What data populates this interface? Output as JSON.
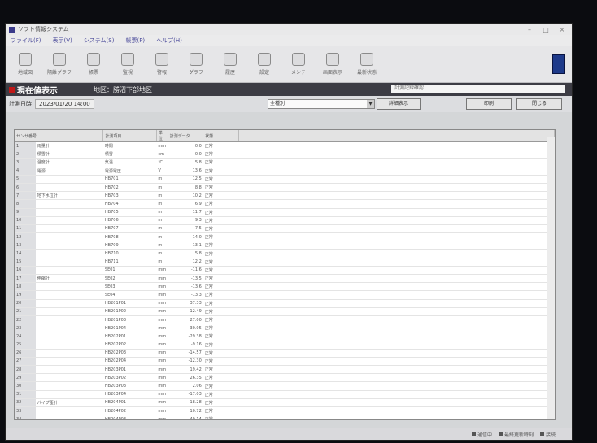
{
  "window": {
    "title": "ソフト情報システム"
  },
  "menu": [
    "ファイル(F)",
    "表示(V)",
    "システム(S)",
    "帳票(P)",
    "ヘルプ(H)"
  ],
  "toolbar": [
    {
      "label": "地域図",
      "icon": "map-icon"
    },
    {
      "label": "隔離グラフ",
      "icon": "graph-icon"
    },
    {
      "label": "帳票",
      "icon": "report-icon"
    },
    {
      "label": "監視",
      "icon": "monitor-icon"
    },
    {
      "label": "警報",
      "icon": "alarm-icon"
    },
    {
      "label": "グラフ",
      "icon": "chart-icon"
    },
    {
      "label": "履歴",
      "icon": "history-icon"
    },
    {
      "label": "設定",
      "icon": "settings-icon"
    },
    {
      "label": "メンテ",
      "icon": "maintenance-icon"
    },
    {
      "label": "画面表示",
      "icon": "display-icon"
    },
    {
      "label": "最新状態",
      "icon": "refresh-icon"
    }
  ],
  "header": {
    "title": "現在値表示",
    "area": "地区：勝沼下部地区",
    "record_label": "計測記録確認"
  },
  "controls": {
    "datetime_label": "計測日時",
    "datetime": "2023/01/20 14:00",
    "filter_value": "全種別",
    "detail_button": "詳細表示",
    "print_button": "印刷",
    "close_button": "閉じる"
  },
  "table": {
    "headers": [
      "センサ番号",
      "計測項目",
      "単位",
      "計測データ",
      "状態"
    ],
    "rows": [
      {
        "id": "1",
        "name": "雨量計",
        "item": "時間",
        "unit": "mm",
        "value": "0.0",
        "status": "正常"
      },
      {
        "id": "2",
        "name": "積雪計",
        "item": "積雪",
        "unit": "cm",
        "value": "0.0",
        "status": "正常"
      },
      {
        "id": "3",
        "name": "温度計",
        "item": "気温",
        "unit": "℃",
        "value": "5.8",
        "status": "正常"
      },
      {
        "id": "4",
        "name": "電源",
        "item": "電源電圧",
        "unit": "V",
        "value": "13.6",
        "status": "正常"
      },
      {
        "id": "5",
        "name": "",
        "item": "HB701",
        "unit": "m",
        "value": "12.5",
        "status": "正常"
      },
      {
        "id": "6",
        "name": "",
        "item": "HB702",
        "unit": "m",
        "value": "8.8",
        "status": "正常"
      },
      {
        "id": "7",
        "name": "地下水位計",
        "item": "HB703",
        "unit": "m",
        "value": "10.2",
        "status": "正常"
      },
      {
        "id": "8",
        "name": "",
        "item": "HB704",
        "unit": "m",
        "value": "6.9",
        "status": "正常"
      },
      {
        "id": "9",
        "name": "",
        "item": "HB705",
        "unit": "m",
        "value": "11.7",
        "status": "正常"
      },
      {
        "id": "10",
        "name": "",
        "item": "HB706",
        "unit": "m",
        "value": "9.3",
        "status": "正常"
      },
      {
        "id": "11",
        "name": "",
        "item": "HB707",
        "unit": "m",
        "value": "7.5",
        "status": "正常"
      },
      {
        "id": "12",
        "name": "",
        "item": "HB708",
        "unit": "m",
        "value": "14.0",
        "status": "正常"
      },
      {
        "id": "13",
        "name": "",
        "item": "HB709",
        "unit": "m",
        "value": "13.1",
        "status": "正常"
      },
      {
        "id": "14",
        "name": "",
        "item": "HB710",
        "unit": "m",
        "value": "5.8",
        "status": "正常"
      },
      {
        "id": "15",
        "name": "",
        "item": "HB711",
        "unit": "m",
        "value": "12.2",
        "status": "正常"
      },
      {
        "id": "16",
        "name": "",
        "item": "SE01",
        "unit": "mm",
        "value": "-11.6",
        "status": "正常"
      },
      {
        "id": "17",
        "name": "伸縮計",
        "item": "SE02",
        "unit": "mm",
        "value": "-13.5",
        "status": "正常"
      },
      {
        "id": "18",
        "name": "",
        "item": "SE03",
        "unit": "mm",
        "value": "-13.6",
        "status": "正常"
      },
      {
        "id": "19",
        "name": "",
        "item": "SE04",
        "unit": "mm",
        "value": "-13.3",
        "status": "正常"
      },
      {
        "id": "20",
        "name": "",
        "item": "HB201P01",
        "unit": "mm",
        "value": "37.33",
        "status": "正常"
      },
      {
        "id": "21",
        "name": "",
        "item": "HB201P02",
        "unit": "mm",
        "value": "12.49",
        "status": "正常"
      },
      {
        "id": "22",
        "name": "",
        "item": "HB201P03",
        "unit": "mm",
        "value": "27.00",
        "status": "正常"
      },
      {
        "id": "23",
        "name": "",
        "item": "HB201P04",
        "unit": "mm",
        "value": "30.05",
        "status": "正常"
      },
      {
        "id": "24",
        "name": "",
        "item": "HB202P01",
        "unit": "mm",
        "value": "-29.38",
        "status": "正常"
      },
      {
        "id": "25",
        "name": "",
        "item": "HB202P02",
        "unit": "mm",
        "value": "-9.16",
        "status": "正常"
      },
      {
        "id": "26",
        "name": "",
        "item": "HB202P03",
        "unit": "mm",
        "value": "-14.57",
        "status": "正常"
      },
      {
        "id": "27",
        "name": "",
        "item": "HB202P04",
        "unit": "mm",
        "value": "-12.30",
        "status": "正常"
      },
      {
        "id": "28",
        "name": "",
        "item": "HB203P01",
        "unit": "mm",
        "value": "19.42",
        "status": "正常"
      },
      {
        "id": "29",
        "name": "",
        "item": "HB203P02",
        "unit": "mm",
        "value": "26.35",
        "status": "正常"
      },
      {
        "id": "30",
        "name": "",
        "item": "HB203P03",
        "unit": "mm",
        "value": "2.06",
        "status": "正常"
      },
      {
        "id": "31",
        "name": "",
        "item": "HB203P04",
        "unit": "mm",
        "value": "-17.03",
        "status": "正常"
      },
      {
        "id": "32",
        "name": "パイプ歪計",
        "item": "HB204P01",
        "unit": "mm",
        "value": "18.28",
        "status": "正常"
      },
      {
        "id": "33",
        "name": "",
        "item": "HB204P02",
        "unit": "mm",
        "value": "10.72",
        "status": "正常"
      },
      {
        "id": "34",
        "name": "",
        "item": "HB204P03",
        "unit": "mm",
        "value": "-49.14",
        "status": "正常"
      },
      {
        "id": "35",
        "name": "",
        "item": "HB204P04",
        "unit": "mm",
        "value": "-11.06",
        "status": "正常"
      },
      {
        "id": "36",
        "name": "",
        "item": "HB205P01",
        "unit": "mm",
        "value": "-20.16",
        "status": "正常"
      },
      {
        "id": "37",
        "name": "",
        "item": "HB205P02",
        "unit": "mm",
        "value": "23.88",
        "status": "正常"
      },
      {
        "id": "38",
        "name": "",
        "item": "HB205P03",
        "unit": "mm",
        "value": "11.34",
        "status": "正常"
      }
    ]
  },
  "statusbar": {
    "items": [
      "通信中",
      "最終更新時刻",
      "接続"
    ]
  }
}
